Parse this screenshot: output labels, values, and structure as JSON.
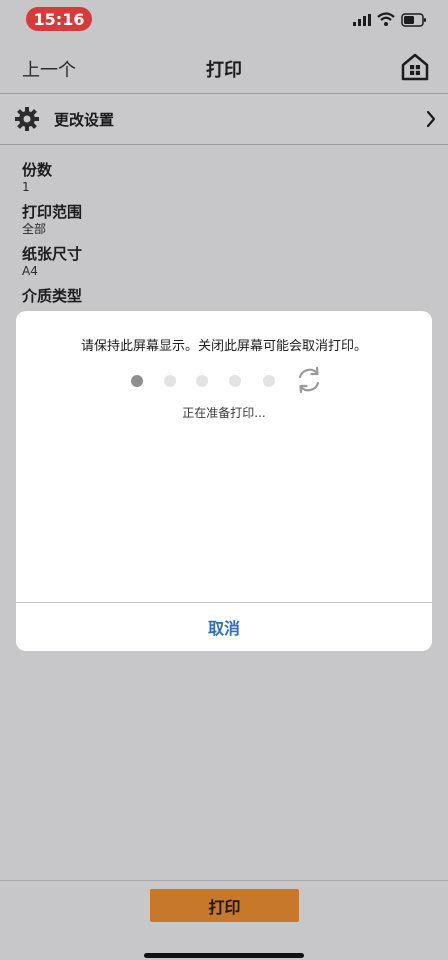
{
  "status_bar": {
    "time": "15:16",
    "time_pill_color": "#d63a3a",
    "icons": [
      "signal-icon",
      "wifi-icon",
      "battery-icon"
    ]
  },
  "nav": {
    "back_label": "上一个",
    "title": "打印",
    "home_icon": "home-icon"
  },
  "settings_row": {
    "label": "更改设置",
    "icon": "gear-icon",
    "chevron": "chevron-right-icon"
  },
  "settings": [
    {
      "title": "份数",
      "value": "1"
    },
    {
      "title": "打印范围",
      "value": "全部"
    },
    {
      "title": "纸张尺寸",
      "value": "A4"
    },
    {
      "title": "介质类型",
      "value": ""
    }
  ],
  "dialog": {
    "message": "请保持此屏幕显示。关闭此屏幕可能会取消打印。",
    "progress": {
      "total_steps": 5,
      "current_step": 1
    },
    "status": "正在准备打印...",
    "cancel_label": "取消",
    "accent_color": "#2f6fbf"
  },
  "bottom": {
    "print_label": "打印",
    "print_color": "#c8782a"
  }
}
